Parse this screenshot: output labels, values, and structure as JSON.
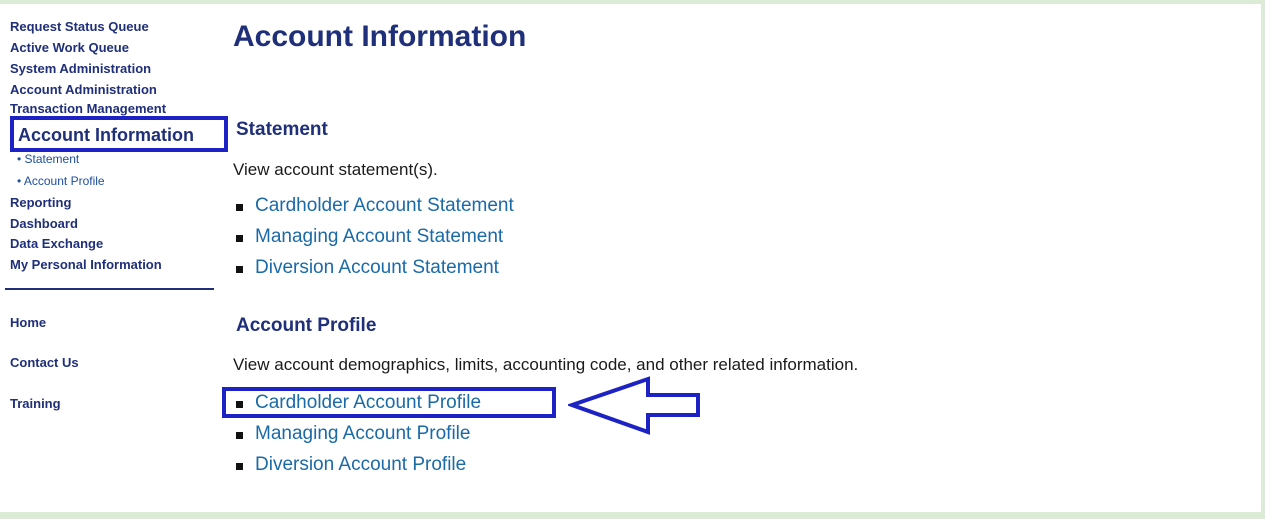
{
  "sidebar": {
    "links": [
      "Request Status Queue",
      "Active Work Queue",
      "System Administration",
      "Account Administration",
      "Transaction Management"
    ],
    "active_section": "Account Information",
    "sub_items": [
      "• Statement",
      "• Account Profile"
    ],
    "links_after": [
      "Reporting",
      "Dashboard",
      "Data Exchange",
      "My Personal Information"
    ],
    "footer_links": [
      "Home",
      "Contact Us",
      "Training"
    ]
  },
  "main": {
    "title": "Account Information",
    "sections": [
      {
        "heading": "Statement",
        "description": "View account statement(s).",
        "links": [
          "Cardholder Account Statement",
          "Managing Account Statement",
          "Diversion Account Statement"
        ]
      },
      {
        "heading": "Account Profile",
        "description": "View account demographics, limits, accounting code, and other related information.",
        "links": [
          "Cardholder Account Profile",
          "Managing Account Profile",
          "Diversion Account Profile"
        ]
      }
    ]
  },
  "annotation": {
    "highlight_color": "#1d22c4"
  },
  "colors": {
    "heading_navy": "#1f2f7a",
    "link_blue": "#1a6aa8",
    "frame_green": "#dcebd6"
  }
}
